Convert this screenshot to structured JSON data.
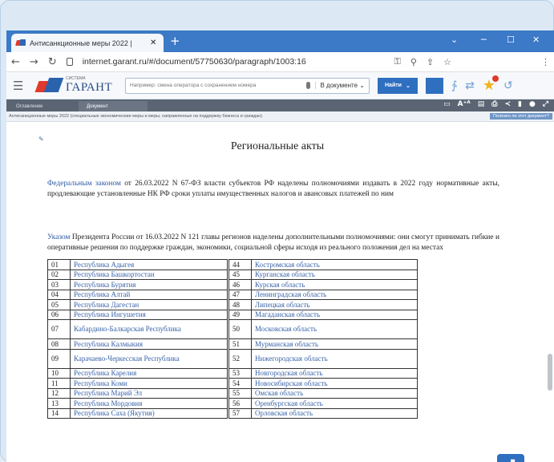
{
  "browser": {
    "tab_title": "Антисанкционные меры 2022 | ",
    "tab_close": "✕",
    "new_tab": "+",
    "win_min": "─",
    "win_max": "☐",
    "win_close": "✕",
    "win_chevron": "⌄",
    "url": "internet.garant.ru/#/document/57750630/paragraph/1003:16"
  },
  "garant": {
    "logo_sys": "СИСТЕМА",
    "logo_name": "ГАРАНТ",
    "search_placeholder": "Например: смена оператора с сохранением номера",
    "scope": "В документе ⌄",
    "find": "Найти"
  },
  "doc_tabs": [
    "Оглавление",
    "Документ"
  ],
  "breadcrumb": "Антисанкционные меры 2022 (специальные экономические меры и меры, направленные на поддержку бизнеса и граждан)",
  "feedback": "Полезен ли этот документ?",
  "document": {
    "title": "Региональные акты",
    "p1_link": "Федеральным законом",
    "p1_text": " от 26.03.2022 N 67-ФЗ власти субъектов РФ наделены полномочиями издавать в 2022 году нормативные акты, продлевающие установленные НК РФ сроки уплаты имущественных налогов и авансовых платежей по ним",
    "p2_link": "Указом",
    "p2_text": " Президента России от 16.03.2022 N 121 главы регионов наделены дополнительными полномочиями: они смогут принимать гибкие и оперативные решения по поддержке граждан, экономики, социальной сферы исходя из реального положения дел на местах"
  },
  "regions_left": [
    {
      "code": "01",
      "name": "Республика Адыгея"
    },
    {
      "code": "02",
      "name": "Республика Башкортостан"
    },
    {
      "code": "03",
      "name": "Республика Бурятия"
    },
    {
      "code": "04",
      "name": "Республика Алтай"
    },
    {
      "code": "05",
      "name": "Республика Дагестан"
    },
    {
      "code": "06",
      "name": "Республика Ингушетия"
    },
    {
      "code": "07",
      "name": "Кабардино-Балкарская Республика"
    },
    {
      "code": "08",
      "name": "Республика Калмыкия"
    },
    {
      "code": "09",
      "name": "Карачаево-Черкесская Республика"
    },
    {
      "code": "10",
      "name": "Республика Карелия"
    },
    {
      "code": "11",
      "name": "Республика Коми"
    },
    {
      "code": "12",
      "name": "Республика Марий Эл"
    },
    {
      "code": "13",
      "name": "Республика Мордовия"
    },
    {
      "code": "14",
      "name": "Республика Саха (Якутия)"
    }
  ],
  "regions_right": [
    {
      "code": "44",
      "name": "Костромская область"
    },
    {
      "code": "45",
      "name": "Курганская область"
    },
    {
      "code": "46",
      "name": "Курская область"
    },
    {
      "code": "47",
      "name": "Ленинградская область"
    },
    {
      "code": "48",
      "name": "Липецкая область"
    },
    {
      "code": "49",
      "name": "Магаданская область"
    },
    {
      "code": "50",
      "name": "Московская область"
    },
    {
      "code": "51",
      "name": "Мурманская область"
    },
    {
      "code": "52",
      "name": "Нижегородская область"
    },
    {
      "code": "53",
      "name": "Новгородская область"
    },
    {
      "code": "54",
      "name": "Новосибирская область"
    },
    {
      "code": "55",
      "name": "Омская область"
    },
    {
      "code": "56",
      "name": "Оренбургская область"
    },
    {
      "code": "57",
      "name": "Орловская область"
    }
  ],
  "tall_rows": [
    6,
    8
  ]
}
